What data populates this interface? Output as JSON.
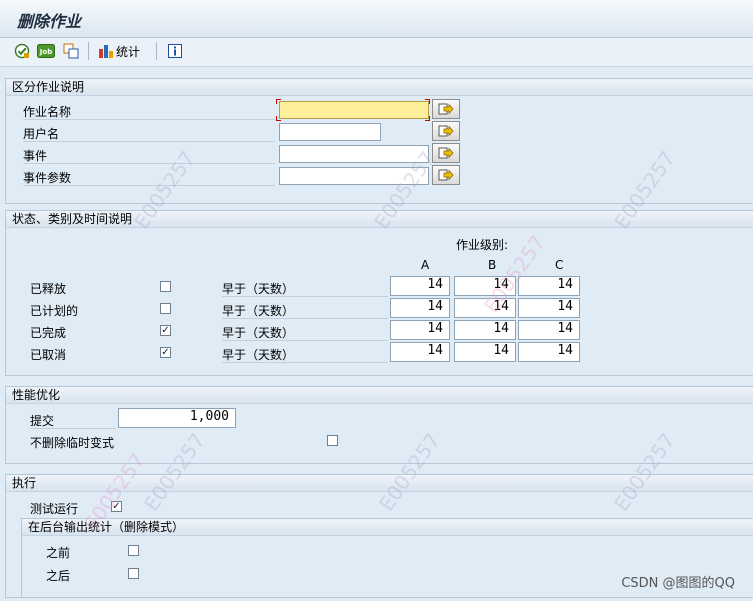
{
  "title": "删除作业",
  "toolbar": {
    "job_icon_text": "Job",
    "stats_label": "统计"
  },
  "group1": {
    "header": "区分作业说明",
    "rows": [
      {
        "label": "作业名称",
        "value": ""
      },
      {
        "label": "用户名",
        "value": ""
      },
      {
        "label": "事件",
        "value": ""
      },
      {
        "label": "事件参数",
        "value": ""
      }
    ]
  },
  "group2": {
    "header": "状态、类别及时间说明",
    "job_class_label": "作业级别:",
    "col_headers": [
      "A",
      "B",
      "C"
    ],
    "rows": [
      {
        "label": "已释放",
        "checked": false,
        "check_mark": "",
        "desc": "早于（天数）",
        "a": "14",
        "b": "14",
        "c": "14"
      },
      {
        "label": "已计划的",
        "checked": false,
        "check_mark": "",
        "desc": "早于（天数）",
        "a": "14",
        "b": "14",
        "c": "14"
      },
      {
        "label": "已完成",
        "checked": true,
        "check_mark": "✓",
        "desc": "早于（天数）",
        "a": "14",
        "b": "14",
        "c": "14"
      },
      {
        "label": "已取消",
        "checked": true,
        "check_mark": "✓",
        "desc": "早于（天数）",
        "a": "14",
        "b": "14",
        "c": "14"
      }
    ]
  },
  "group3": {
    "header": "性能优化",
    "commit_label": "提交",
    "commit_value": "1,000",
    "no_delete_temp_label": "不删除临时变式",
    "no_delete_temp_check": ""
  },
  "group4": {
    "header": "执行",
    "test_run_label": "测试运行",
    "test_run_check": "✓",
    "sub_header": "在后台输出统计（删除模式）",
    "before_label": "之前",
    "before_check": "",
    "after_label": "之后",
    "after_check": ""
  },
  "watermark": {
    "text": "E005257",
    "credit": "CSDN @图图的QQ"
  },
  "colors": {
    "required_field": "#fdee9a",
    "background": "#dfebf5"
  }
}
